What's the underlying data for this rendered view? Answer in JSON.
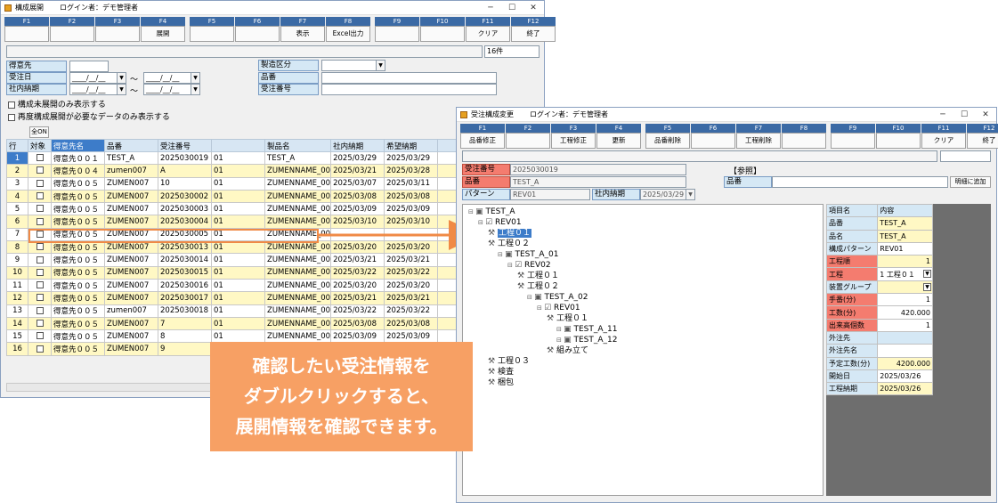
{
  "left": {
    "title": "構成展開",
    "login": "ログイン者：デモ管理者",
    "fkeys": [
      {
        "k": "F1",
        "label": ""
      },
      {
        "k": "F2",
        "label": ""
      },
      {
        "k": "F3",
        "label": ""
      },
      {
        "k": "F4",
        "label": "展開"
      },
      {
        "k": "F5",
        "label": ""
      },
      {
        "k": "F6",
        "label": ""
      },
      {
        "k": "F7",
        "label": "表示"
      },
      {
        "k": "F8",
        "label": "Excel出力"
      },
      {
        "k": "F9",
        "label": ""
      },
      {
        "k": "F10",
        "label": ""
      },
      {
        "k": "F11",
        "label": "クリア"
      },
      {
        "k": "F12",
        "label": "終了"
      }
    ],
    "count": "16件",
    "filters": {
      "customer": "得意先",
      "order_date": "受注日",
      "internal_delivery": "社内納期",
      "date_placeholder": "____/__/__",
      "tilde": "～",
      "mfg_type": "製造区分",
      "part_no": "品番",
      "order_no": "受注番号"
    },
    "checks": [
      "構成未展開のみ表示する",
      "再度構成展開が必要なデータのみ表示する"
    ],
    "all_on": "全ON",
    "columns": [
      "行",
      "対象",
      "得意先名",
      "品番",
      "受注番号",
      "",
      "製品名",
      "社内納期",
      "希望納期"
    ],
    "rows": [
      {
        "n": "1",
        "cust": "得意先００１",
        "part": "TEST_A",
        "order": "2025030019",
        "sub": "01",
        "prod": "TEST_A",
        "d1": "2025/03/29",
        "d2": "2025/03/29"
      },
      {
        "n": "2",
        "cust": "得意先００４",
        "part": "zumen007",
        "order": "A",
        "sub": "01",
        "prod": "ZUMENNAME_00",
        "d1": "2025/03/21",
        "d2": "2025/03/28"
      },
      {
        "n": "3",
        "cust": "得意先００５",
        "part": "ZUMEN007",
        "order": "10",
        "sub": "01",
        "prod": "ZUMENNAME_00",
        "d1": "2025/03/07",
        "d2": "2025/03/11"
      },
      {
        "n": "4",
        "cust": "得意先００５",
        "part": "ZUMEN007",
        "order": "2025030002",
        "sub": "01",
        "prod": "ZUMENNAME_00",
        "d1": "2025/03/08",
        "d2": "2025/03/08"
      },
      {
        "n": "5",
        "cust": "得意先００５",
        "part": "ZUMEN007",
        "order": "2025030003",
        "sub": "01",
        "prod": "ZUMENNAME_00",
        "d1": "2025/03/09",
        "d2": "2025/03/09"
      },
      {
        "n": "6",
        "cust": "得意先００５",
        "part": "ZUMEN007",
        "order": "2025030004",
        "sub": "01",
        "prod": "ZUMENNAME_00",
        "d1": "2025/03/10",
        "d2": "2025/03/10"
      },
      {
        "n": "7",
        "cust": "得意先００５",
        "part": "ZUMEN007",
        "order": "2025030005",
        "sub": "01",
        "prod": "ZUMENNAME_00",
        "d1": "",
        "d2": ""
      },
      {
        "n": "8",
        "cust": "得意先００５",
        "part": "ZUMEN007",
        "order": "2025030013",
        "sub": "01",
        "prod": "ZUMENNAME_00",
        "d1": "2025/03/20",
        "d2": "2025/03/20"
      },
      {
        "n": "9",
        "cust": "得意先００５",
        "part": "ZUMEN007",
        "order": "2025030014",
        "sub": "01",
        "prod": "ZUMENNAME_00",
        "d1": "2025/03/21",
        "d2": "2025/03/21"
      },
      {
        "n": "10",
        "cust": "得意先００５",
        "part": "ZUMEN007",
        "order": "2025030015",
        "sub": "01",
        "prod": "ZUMENNAME_00",
        "d1": "2025/03/22",
        "d2": "2025/03/22"
      },
      {
        "n": "11",
        "cust": "得意先００５",
        "part": "ZUMEN007",
        "order": "2025030016",
        "sub": "01",
        "prod": "ZUMENNAME_00",
        "d1": "2025/03/20",
        "d2": "2025/03/20"
      },
      {
        "n": "12",
        "cust": "得意先００５",
        "part": "ZUMEN007",
        "order": "2025030017",
        "sub": "01",
        "prod": "ZUMENNAME_00",
        "d1": "2025/03/21",
        "d2": "2025/03/21"
      },
      {
        "n": "13",
        "cust": "得意先００５",
        "part": "zumen007",
        "order": "2025030018",
        "sub": "01",
        "prod": "ZUMENNAME_00",
        "d1": "2025/03/22",
        "d2": "2025/03/22"
      },
      {
        "n": "14",
        "cust": "得意先００５",
        "part": "ZUMEN007",
        "order": "7",
        "sub": "01",
        "prod": "ZUMENNAME_00",
        "d1": "2025/03/08",
        "d2": "2025/03/08"
      },
      {
        "n": "15",
        "cust": "得意先００５",
        "part": "ZUMEN007",
        "order": "8",
        "sub": "01",
        "prod": "ZUMENNAME_00",
        "d1": "2025/03/09",
        "d2": "2025/03/09"
      },
      {
        "n": "16",
        "cust": "得意先００５",
        "part": "ZUMEN007",
        "order": "9",
        "sub": "",
        "prod": "",
        "d1": "",
        "d2": ""
      }
    ]
  },
  "right": {
    "title": "受注構成変更",
    "login": "ログイン者：デモ管理者",
    "fkeys": [
      {
        "k": "F1",
        "label": "品番修正"
      },
      {
        "k": "F2",
        "label": ""
      },
      {
        "k": "F3",
        "label": "工程修正"
      },
      {
        "k": "F4",
        "label": "更新"
      },
      {
        "k": "F5",
        "label": "品番削除"
      },
      {
        "k": "F6",
        "label": ""
      },
      {
        "k": "F7",
        "label": "工程削除"
      },
      {
        "k": "F8",
        "label": ""
      },
      {
        "k": "F9",
        "label": ""
      },
      {
        "k": "F10",
        "label": ""
      },
      {
        "k": "F11",
        "label": "クリア"
      },
      {
        "k": "F12",
        "label": "終了"
      }
    ],
    "order_no_label": "受注番号",
    "order_no": "2025030019",
    "part_label": "品番",
    "part": "TEST_A",
    "pattern_label": "パターン",
    "pattern": "REV01",
    "delivery_label": "社内納期",
    "delivery": "2025/03/29",
    "ref_label": "【参照】",
    "ref_part_label": "品番",
    "add_button": "明細に追加",
    "tree": [
      {
        "t": "TEST_A",
        "l": 0,
        "ic": "box"
      },
      {
        "t": "REV01",
        "l": 1,
        "ic": "rev"
      },
      {
        "t": "工程０１",
        "l": 2,
        "ic": "proc",
        "sel": true
      },
      {
        "t": "工程０２",
        "l": 2,
        "ic": "proc"
      },
      {
        "t": "TEST_A_01",
        "l": 3,
        "ic": "box"
      },
      {
        "t": "REV02",
        "l": 4,
        "ic": "rev"
      },
      {
        "t": "工程０１",
        "l": 5,
        "ic": "proc"
      },
      {
        "t": "工程０２",
        "l": 5,
        "ic": "proc"
      },
      {
        "t": "TEST_A_02",
        "l": 6,
        "ic": "box"
      },
      {
        "t": "REV01",
        "l": 7,
        "ic": "rev"
      },
      {
        "t": "工程０１",
        "l": 8,
        "ic": "proc"
      },
      {
        "t": "TEST_A_11",
        "l": 9,
        "ic": "box"
      },
      {
        "t": "TEST_A_12",
        "l": 9,
        "ic": "box"
      },
      {
        "t": "組み立て",
        "l": 8,
        "ic": "proc"
      },
      {
        "t": "工程０３",
        "l": 2,
        "ic": "proc"
      },
      {
        "t": "検査",
        "l": 2,
        "ic": "proc"
      },
      {
        "t": "梱包",
        "l": 2,
        "ic": "proc"
      }
    ],
    "props_header": {
      "k": "項目名",
      "v": "内容"
    },
    "props": [
      {
        "k": "品番",
        "v": "TEST_A",
        "c": "blu",
        "vc": "y"
      },
      {
        "k": "品名",
        "v": "TEST_A",
        "c": "blu",
        "vc": "y"
      },
      {
        "k": "構成パターン",
        "v": "REV01",
        "c": "blu",
        "vc": "w"
      },
      {
        "k": "工程順",
        "v": "1",
        "c": "red",
        "vc": "y",
        "r": true
      },
      {
        "k": "工程",
        "v": "1 工程０１",
        "c": "red",
        "vc": "w",
        "dd": true
      },
      {
        "k": "装置グループ",
        "v": "",
        "c": "blu",
        "vc": "y",
        "dd": true
      },
      {
        "k": "手番(分)",
        "v": "1",
        "c": "red",
        "vc": "w",
        "r": true
      },
      {
        "k": "工数(分)",
        "v": "420.000",
        "c": "red",
        "vc": "w",
        "r": true
      },
      {
        "k": "出来高個数",
        "v": "1",
        "c": "red",
        "vc": "w",
        "r": true
      },
      {
        "k": "外注先",
        "v": "",
        "c": "blu",
        "vc": "b"
      },
      {
        "k": "外注先名",
        "v": "",
        "c": "blu",
        "vc": "w"
      },
      {
        "k": "予定工数(分)",
        "v": "4200.000",
        "c": "blu",
        "vc": "y",
        "r": true
      },
      {
        "k": "開始日",
        "v": "2025/03/26",
        "c": "blu",
        "vc": "w"
      },
      {
        "k": "工程納期",
        "v": "2025/03/26",
        "c": "blu",
        "vc": "y"
      }
    ]
  },
  "callout": {
    "line1": "確認したい受注情報を",
    "line2": "ダブルクリックすると、",
    "line3": "展開情報を確認できます。"
  },
  "colors": {
    "accent": "#f08a46",
    "fkey": "#3b6aa5",
    "required": "#f47c6f",
    "label": "#d5e8f5",
    "row_yellow": "#fff8c4"
  }
}
